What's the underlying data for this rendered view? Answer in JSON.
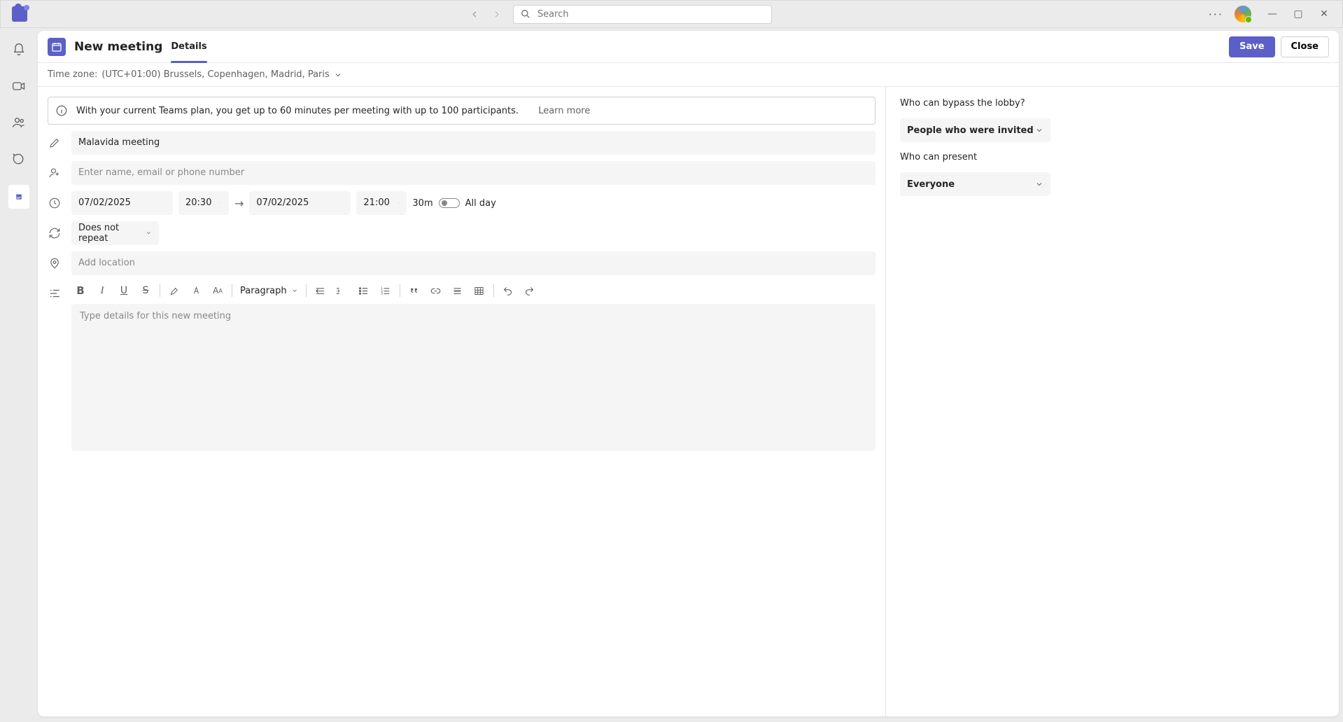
{
  "titlebar": {
    "search_placeholder": "Search"
  },
  "page": {
    "title": "New meeting",
    "tab_details": "Details",
    "save_label": "Save",
    "close_label": "Close",
    "timezone_label": "Time zone:",
    "timezone_value": "(UTC+01:00) Brussels, Copenhagen, Madrid, Paris"
  },
  "notice": {
    "text": "With your current Teams plan, you get up to 60 minutes per meeting with up to 100 participants.",
    "learn_more": "Learn more"
  },
  "form": {
    "title_value": "Malavida meeting",
    "attendees_placeholder": "Enter name, email or phone number",
    "start_date": "07/02/2025",
    "start_time": "20:30",
    "end_date": "07/02/2025",
    "end_time": "21:00",
    "duration": "30m",
    "all_day_label": "All day",
    "recurrence": "Does not repeat",
    "location_placeholder": "Add location",
    "paragraph_label": "Paragraph",
    "details_placeholder": "Type details for this new meeting"
  },
  "options": {
    "bypass_lobby_label": "Who can bypass the lobby?",
    "bypass_lobby_value": "People who were invited",
    "present_label": "Who can present",
    "present_value": "Everyone"
  }
}
